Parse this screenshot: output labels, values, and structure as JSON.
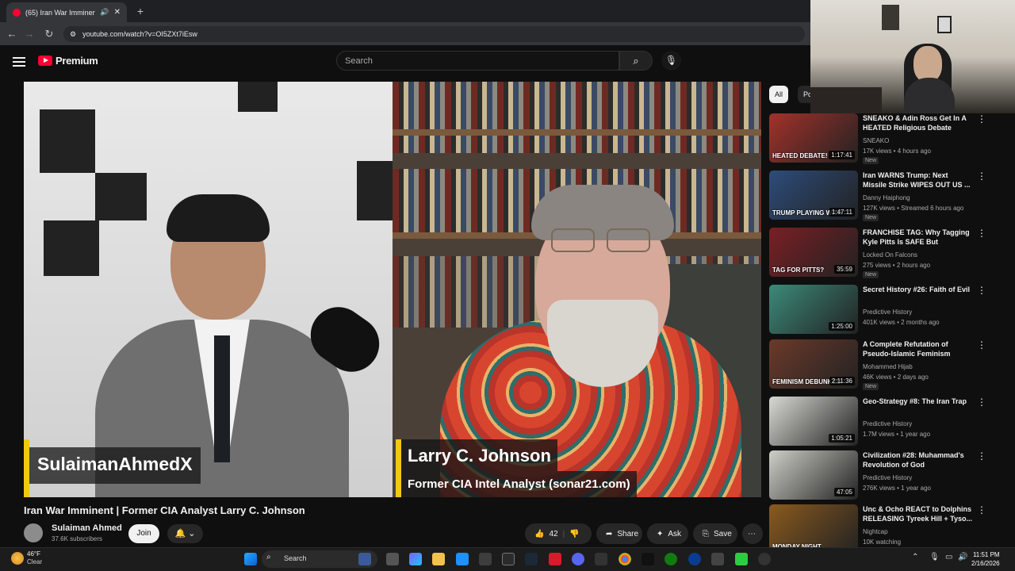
{
  "browser": {
    "tab_title": "(65) Iran War Imminent | Fo",
    "url": "youtube.com/watch?v=OI5ZXt7iEsw"
  },
  "header": {
    "brand": "Premium",
    "search_placeholder": "Search"
  },
  "video": {
    "left_lower_third": "SulaimanAhmedX",
    "right_name": "Larry C. Johnson",
    "right_subtitle": "Former CIA Intel Analyst (sonar21.com)",
    "title": "Iran War Imminent | Former CIA Analyst Larry C. Johnson",
    "channel": "Sulaiman Ahmed",
    "subscribers": "37.6K subscribers",
    "join_label": "Join",
    "likes": "42",
    "share_label": "Share",
    "ask_label": "Ask",
    "save_label": "Save"
  },
  "sidebar": {
    "chips": [
      "All",
      "Po"
    ],
    "items": [
      {
        "title": "SNEAKO & Adin Ross Get In A HEATED Religious Debate",
        "channel": "SNEAKO",
        "meta": "17K views • 4 hours ago",
        "badge": "New",
        "duration": "1:17:41",
        "overlay": "HEATED DEBATE!",
        "color": "#a3312a"
      },
      {
        "title": "Iran WARNS Trump: Next Missile Strike WIPES OUT US ...",
        "channel": "Danny Haiphong",
        "meta": "127K views • Streamed 6 hours ago",
        "badge": "New",
        "duration": "1:47:11",
        "overlay": "TRUMP PLAYING WITH",
        "color": "#2d4c7a"
      },
      {
        "title": "FRANCHISE TAG: Why Tagging Kyle Pitts Is SAFE But WRONG...",
        "channel": "Locked On Falcons",
        "meta": "275 views • 2 hours ago",
        "badge": "New",
        "duration": "35:59",
        "overlay": "TAG FOR PITTS?",
        "color": "#7a1f24"
      },
      {
        "title": "Secret History #26: Faith of Evil",
        "channel": "Predictive History",
        "meta": "401K views • 2 months ago",
        "badge": "",
        "duration": "1:25:00",
        "overlay": "",
        "color": "#3c8a7a"
      },
      {
        "title": "A Complete Refutation of Pseudo-Islamic Feminism",
        "channel": "Mohammed Hijab",
        "meta": "46K views • 2 days ago",
        "badge": "New",
        "duration": "2:11:36",
        "overlay": "FEMINISM DEBUNKED",
        "color": "#6b3a2a"
      },
      {
        "title": "Geo-Strategy #8: The Iran Trap",
        "channel": "Predictive History",
        "meta": "1.7M views • 1 year ago",
        "badge": "",
        "duration": "1:05:21",
        "overlay": "",
        "color": "#d9d9d4"
      },
      {
        "title": "Civilization #28: Muhammad's Revolution of God",
        "channel": "Predictive History",
        "meta": "276K views • 1 year ago",
        "badge": "",
        "duration": "47:05",
        "overlay": "",
        "color": "#cfcfc8"
      },
      {
        "title": "Unc & Ocho REACT to Dolphins RELEASING Tyreek Hill + Tyso...",
        "channel": "Nightcap",
        "meta": "10K watching",
        "badge": "",
        "duration": "",
        "overlay": "MONDAY NIGHT",
        "color": "#8a5a1e"
      }
    ]
  },
  "taskbar": {
    "weather_temp": "46°F",
    "weather_desc": "Clear",
    "search_label": "Search",
    "time": "11:51 PM",
    "date": "2/16/2026"
  }
}
